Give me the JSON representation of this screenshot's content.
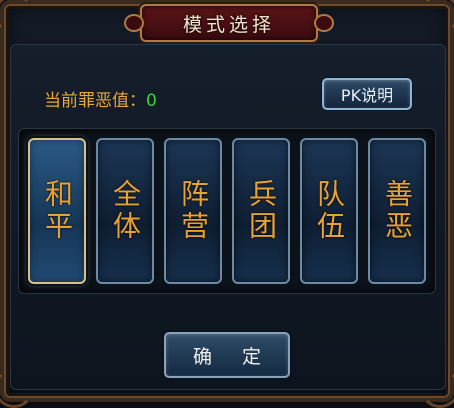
{
  "dialog": {
    "title": "模式选择"
  },
  "karma": {
    "label": "当前罪恶值：",
    "value": "0"
  },
  "pk_help_button": "PK说明",
  "modes": [
    {
      "label": "和平",
      "selected": true
    },
    {
      "label": "全体",
      "selected": false
    },
    {
      "label": "阵营",
      "selected": false
    },
    {
      "label": "兵团",
      "selected": false
    },
    {
      "label": "队伍",
      "selected": false
    },
    {
      "label": "善恶",
      "selected": false
    }
  ],
  "confirm_button": "确 定",
  "colors": {
    "accent": "#e8a233",
    "karma_value": "#36d23a",
    "title_plate": "#5a1418"
  }
}
